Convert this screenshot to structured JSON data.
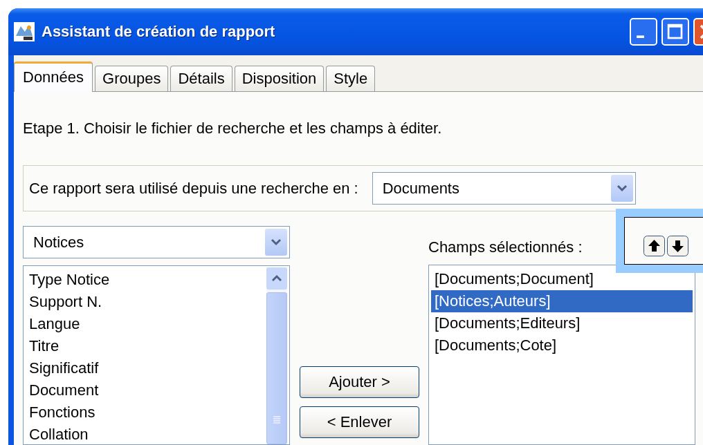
{
  "window": {
    "title": "Assistant de création de rapport"
  },
  "tabs": [
    {
      "label": "Données",
      "selected": true
    },
    {
      "label": "Groupes",
      "selected": false
    },
    {
      "label": "Détails",
      "selected": false
    },
    {
      "label": "Disposition",
      "selected": false
    },
    {
      "label": "Style",
      "selected": false
    }
  ],
  "step_text": "Etape 1. Choisir le fichier de recherche et les champs à éditer.",
  "source": {
    "label": "Ce rapport sera utilisé depuis une recherche en :",
    "value": "Documents"
  },
  "table_select": {
    "value": "Notices"
  },
  "available_fields": [
    {
      "label": "Type Notice",
      "selected": false
    },
    {
      "label": "Support N.",
      "selected": false
    },
    {
      "label": "Langue",
      "selected": false
    },
    {
      "label": "Titre",
      "selected": false
    },
    {
      "label": "Significatif",
      "selected": false
    },
    {
      "label": "Document",
      "selected": false
    },
    {
      "label": "Fonctions",
      "selected": false
    },
    {
      "label": "Collation",
      "selected": false
    }
  ],
  "buttons": [
    {
      "label": "Ajouter >"
    },
    {
      "label": "< Enlever"
    }
  ],
  "selected_fields": {
    "label": "Champs sélectionnés :",
    "items": [
      {
        "label": "[Documents;Document]",
        "selected": false
      },
      {
        "label": "[Notices;Auteurs]",
        "selected": true
      },
      {
        "label": "[Documents;Editeurs]",
        "selected": false
      },
      {
        "label": "[Documents;Cote]",
        "selected": false
      }
    ]
  }
}
